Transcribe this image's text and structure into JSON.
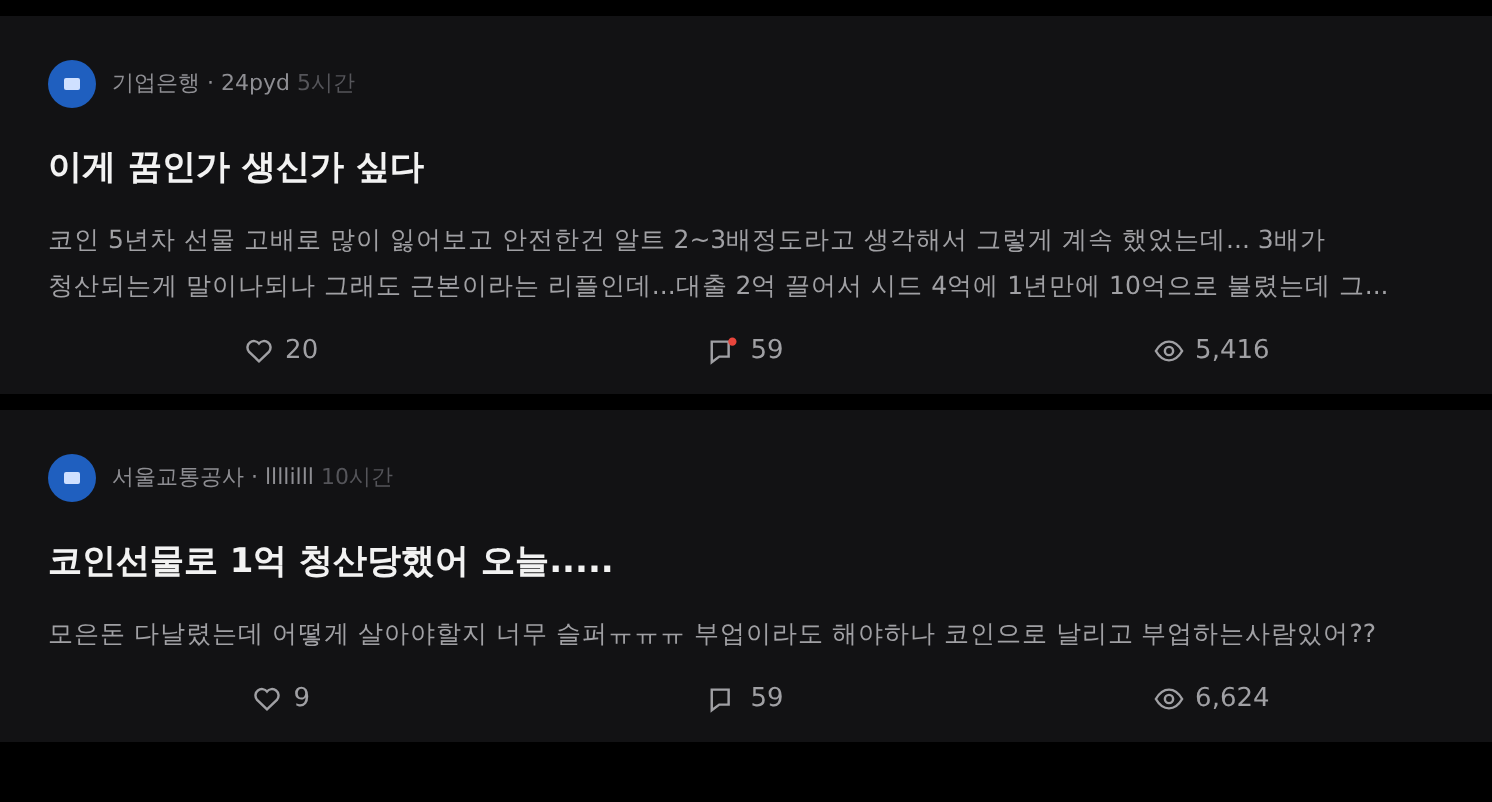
{
  "posts": [
    {
      "byline": "기업은행 · 24pyd",
      "time": "5시간",
      "title": "이게 꿈인가 생신가 싶다",
      "body": "코인 5년차 선물 고배로 많이 잃어보고 안전한건 알트 2~3배정도라고 생각해서 그렇게 계속 했었는데... 3배가 청산되는게 말이나되나 그래도 근본이라는 리플인데...대출 2억 끌어서 시드 4억에 1년만에 10억으로 불렸는데 그...",
      "likes": "20",
      "comments": "59",
      "new_comment": true,
      "views": "5,416"
    },
    {
      "byline": "서울교통공사 · llllilll",
      "time": "10시간",
      "title": "코인선물로 1억 청산당했어 오늘.....",
      "body": "모은돈 다날렸는데 어떻게 살아야할지 너무 슬퍼ㅠㅠㅠ 부업이라도 해야하나  코인으로 날리고 부업하는사람있어??",
      "likes": "9",
      "comments": "59",
      "new_comment": false,
      "views": "6,624"
    }
  ]
}
